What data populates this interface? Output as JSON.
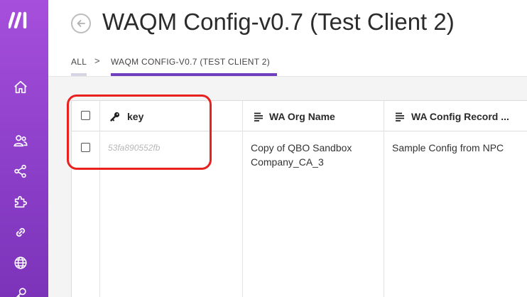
{
  "sidebar": {
    "logo": "make-logo",
    "items": [
      {
        "icon": "home-icon"
      },
      {
        "icon": "team-icon"
      },
      {
        "icon": "share-icon"
      },
      {
        "icon": "puzzle-icon"
      },
      {
        "icon": "link-icon"
      },
      {
        "icon": "globe-icon"
      },
      {
        "icon": "key-icon"
      }
    ]
  },
  "header": {
    "title": "WAQM Config-v0.7 (Test Client 2)"
  },
  "breadcrumb": {
    "all": "ALL",
    "separator": ">",
    "current": "WAQM CONFIG-V0.7 (TEST CLIENT 2)"
  },
  "table": {
    "columns": [
      {
        "label": "key",
        "icon": "key-icon"
      },
      {
        "label": "WA Org Name",
        "icon": "text-align-icon"
      },
      {
        "label": "WA Config Record ...",
        "icon": "text-align-icon"
      }
    ],
    "rows": [
      {
        "key_placeholder": "53fa890552fb",
        "org_name": "Copy of QBO Sandbox Company_CA_3",
        "config_record": "Sample Config from NPC"
      }
    ]
  },
  "colors": {
    "sidebar": "#9a47d4",
    "active_tab": "#6f3fbf",
    "highlight": "#e8211f"
  }
}
